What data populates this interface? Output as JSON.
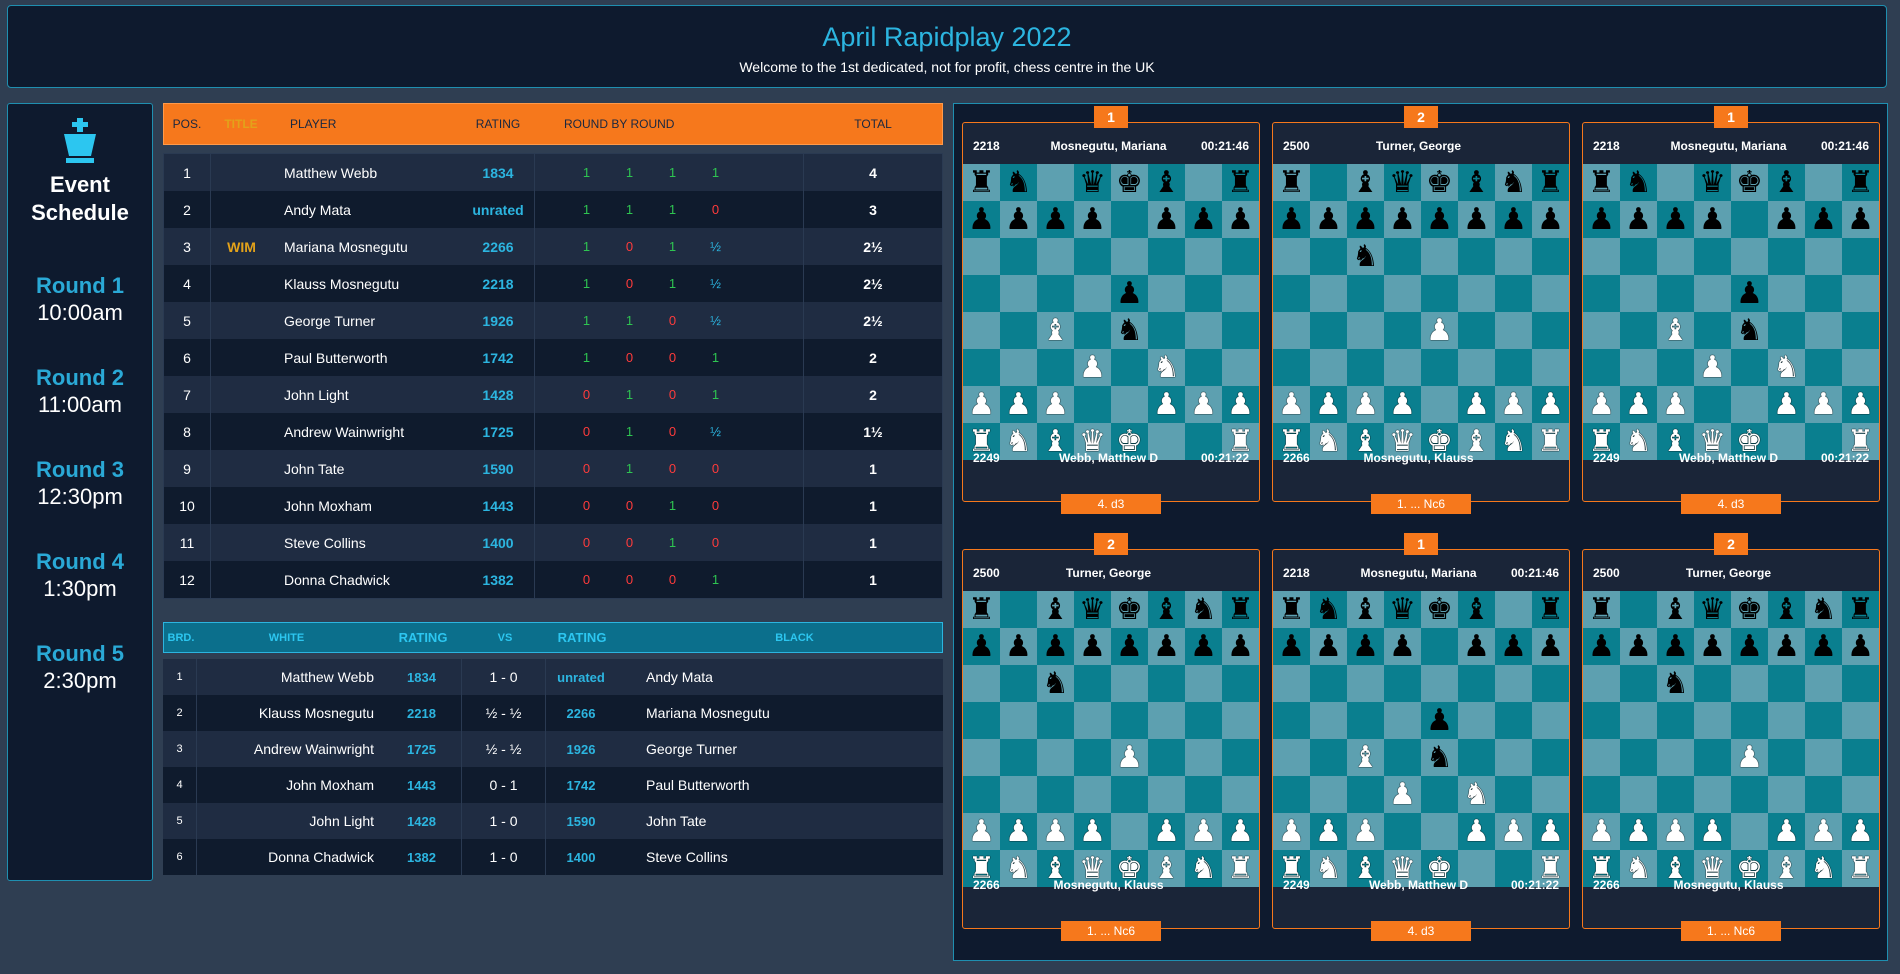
{
  "header": {
    "title": "April Rapidplay 2022",
    "subtitle": "Welcome to the 1st dedicated, not for profit, chess centre in the UK"
  },
  "schedule": {
    "title_line1": "Event",
    "title_line2": "Schedule",
    "rounds": [
      {
        "name": "Round 1",
        "time": "10:00am"
      },
      {
        "name": "Round 2",
        "time": "11:00am"
      },
      {
        "name": "Round 3",
        "time": "12:30pm"
      },
      {
        "name": "Round 4",
        "time": "1:30pm"
      },
      {
        "name": "Round 5",
        "time": "2:30pm"
      }
    ]
  },
  "standings": {
    "headers": {
      "pos": "POS.",
      "title": "TITLE",
      "player": "PLAYER",
      "rating": "RATING",
      "rbr": "ROUND BY ROUND",
      "total": "TOTAL"
    },
    "rows": [
      {
        "pos": "1",
        "title": "",
        "player": "Matthew Webb",
        "rating": "1834",
        "r": [
          "1",
          "1",
          "1",
          "1"
        ],
        "total": "4"
      },
      {
        "pos": "2",
        "title": "",
        "player": "Andy Mata",
        "rating": "unrated",
        "r": [
          "1",
          "1",
          "1",
          "0"
        ],
        "total": "3"
      },
      {
        "pos": "3",
        "title": "WIM",
        "player": "Mariana Mosnegutu",
        "rating": "2266",
        "r": [
          "1",
          "0",
          "1",
          "½"
        ],
        "total": "2½"
      },
      {
        "pos": "4",
        "title": "",
        "player": "Klauss Mosnegutu",
        "rating": "2218",
        "r": [
          "1",
          "0",
          "1",
          "½"
        ],
        "total": "2½"
      },
      {
        "pos": "5",
        "title": "",
        "player": "George Turner",
        "rating": "1926",
        "r": [
          "1",
          "1",
          "0",
          "½"
        ],
        "total": "2½"
      },
      {
        "pos": "6",
        "title": "",
        "player": "Paul Butterworth",
        "rating": "1742",
        "r": [
          "1",
          "0",
          "0",
          "1"
        ],
        "total": "2"
      },
      {
        "pos": "7",
        "title": "",
        "player": "John Light",
        "rating": "1428",
        "r": [
          "0",
          "1",
          "0",
          "1"
        ],
        "total": "2"
      },
      {
        "pos": "8",
        "title": "",
        "player": "Andrew Wainwright",
        "rating": "1725",
        "r": [
          "0",
          "1",
          "0",
          "½"
        ],
        "total": "1½"
      },
      {
        "pos": "9",
        "title": "",
        "player": "John Tate",
        "rating": "1590",
        "r": [
          "0",
          "1",
          "0",
          "0"
        ],
        "total": "1"
      },
      {
        "pos": "10",
        "title": "",
        "player": "John Moxham",
        "rating": "1443",
        "r": [
          "0",
          "0",
          "1",
          "0"
        ],
        "total": "1"
      },
      {
        "pos": "11",
        "title": "",
        "player": "Steve Collins",
        "rating": "1400",
        "r": [
          "0",
          "0",
          "1",
          "0"
        ],
        "total": "1"
      },
      {
        "pos": "12",
        "title": "",
        "player": "Donna Chadwick",
        "rating": "1382",
        "r": [
          "0",
          "0",
          "0",
          "1"
        ],
        "total": "1"
      }
    ]
  },
  "pairings": {
    "headers": {
      "brd": "BRD.",
      "white": "WHITE",
      "wrating": "RATING",
      "vs": "VS",
      "brating": "RATING",
      "black": "BLACK"
    },
    "rows": [
      {
        "brd": "1",
        "white": "Matthew Webb",
        "wr": "1834",
        "res": "1 - 0",
        "br": "unrated",
        "black": "Andy Mata"
      },
      {
        "brd": "2",
        "white": "Klauss Mosnegutu",
        "wr": "2218",
        "res": "½ - ½",
        "br": "2266",
        "black": "Mariana Mosnegutu"
      },
      {
        "brd": "3",
        "white": "Andrew Wainwright",
        "wr": "1725",
        "res": "½ - ½",
        "br": "1926",
        "black": "George Turner"
      },
      {
        "brd": "4",
        "white": "John Moxham",
        "wr": "1443",
        "res": "0 - 1",
        "br": "1742",
        "black": "Paul Butterworth"
      },
      {
        "brd": "5",
        "white": "John Light",
        "wr": "1428",
        "res": "1 - 0",
        "br": "1590",
        "black": "John Tate"
      },
      {
        "brd": "6",
        "white": "Donna Chadwick",
        "wr": "1382",
        "res": "1 - 0",
        "br": "1400",
        "black": "Steve Collins"
      }
    ]
  },
  "boards": [
    {
      "num": "1",
      "top": {
        "rating": "2218",
        "name": "Mosnegutu, Mariana",
        "time": "00:21:46"
      },
      "bottom": {
        "rating": "2249",
        "name": "Webb, Matthew D",
        "time": "00:21:22"
      },
      "move": "4. d3",
      "fen": [
        "rn.qkb.r",
        "pppp.ppp",
        "........",
        "....p...",
        "..B.n...",
        "...P.N..",
        "PPP..PPP",
        "RNBQK..R"
      ]
    },
    {
      "num": "2",
      "top": {
        "rating": "2500",
        "name": "Turner, George",
        "time": ""
      },
      "bottom": {
        "rating": "2266",
        "name": "Mosnegutu, Klauss",
        "time": ""
      },
      "move": "1. ... Nc6",
      "fen": [
        "r.bqkbnr",
        "pppppppp",
        "..n.....",
        "........",
        "....P...",
        "........",
        "PPPP.PPP",
        "RNBQKBNR"
      ]
    },
    {
      "num": "1",
      "top": {
        "rating": "2218",
        "name": "Mosnegutu, Mariana",
        "time": "00:21:46"
      },
      "bottom": {
        "rating": "2249",
        "name": "Webb, Matthew D",
        "time": "00:21:22"
      },
      "move": "4. d3",
      "fen": [
        "rn.qkb.r",
        "pppp.ppp",
        "........",
        "....p...",
        "..B.n...",
        "...P.N..",
        "PPP..PPP",
        "RNBQK..R"
      ]
    },
    {
      "num": "2",
      "top": {
        "rating": "2500",
        "name": "Turner, George",
        "time": ""
      },
      "bottom": {
        "rating": "2266",
        "name": "Mosnegutu, Klauss",
        "time": ""
      },
      "move": "1. ... Nc6",
      "fen": [
        "r.bqkbnr",
        "pppppppp",
        "..n.....",
        "........",
        "....P...",
        "........",
        "PPPP.PPP",
        "RNBQKBNR"
      ]
    },
    {
      "num": "1",
      "top": {
        "rating": "2218",
        "name": "Mosnegutu, Mariana",
        "time": "00:21:46"
      },
      "bottom": {
        "rating": "2249",
        "name": "Webb, Matthew D",
        "time": "00:21:22"
      },
      "move": "4. d3",
      "fen": [
        "rnbqkb.r",
        "pppp.ppp",
        "........",
        "....p...",
        "..B.n...",
        "...P.N..",
        "PPP..PPP",
        "RNBQK..R"
      ]
    },
    {
      "num": "2",
      "top": {
        "rating": "2500",
        "name": "Turner, George",
        "time": ""
      },
      "bottom": {
        "rating": "2266",
        "name": "Mosnegutu, Klauss",
        "time": ""
      },
      "move": "1. ... Nc6",
      "fen": [
        "r.bqkbnr",
        "pppppppp",
        "..n.....",
        "........",
        "....P...",
        "........",
        "PPPP.PPP",
        "RNBQKBNR"
      ]
    }
  ],
  "colors": {
    "accent_orange": "#f6781c",
    "accent_blue": "#2cb5e0",
    "win": "#2ec451",
    "loss": "#ff3b3b"
  }
}
